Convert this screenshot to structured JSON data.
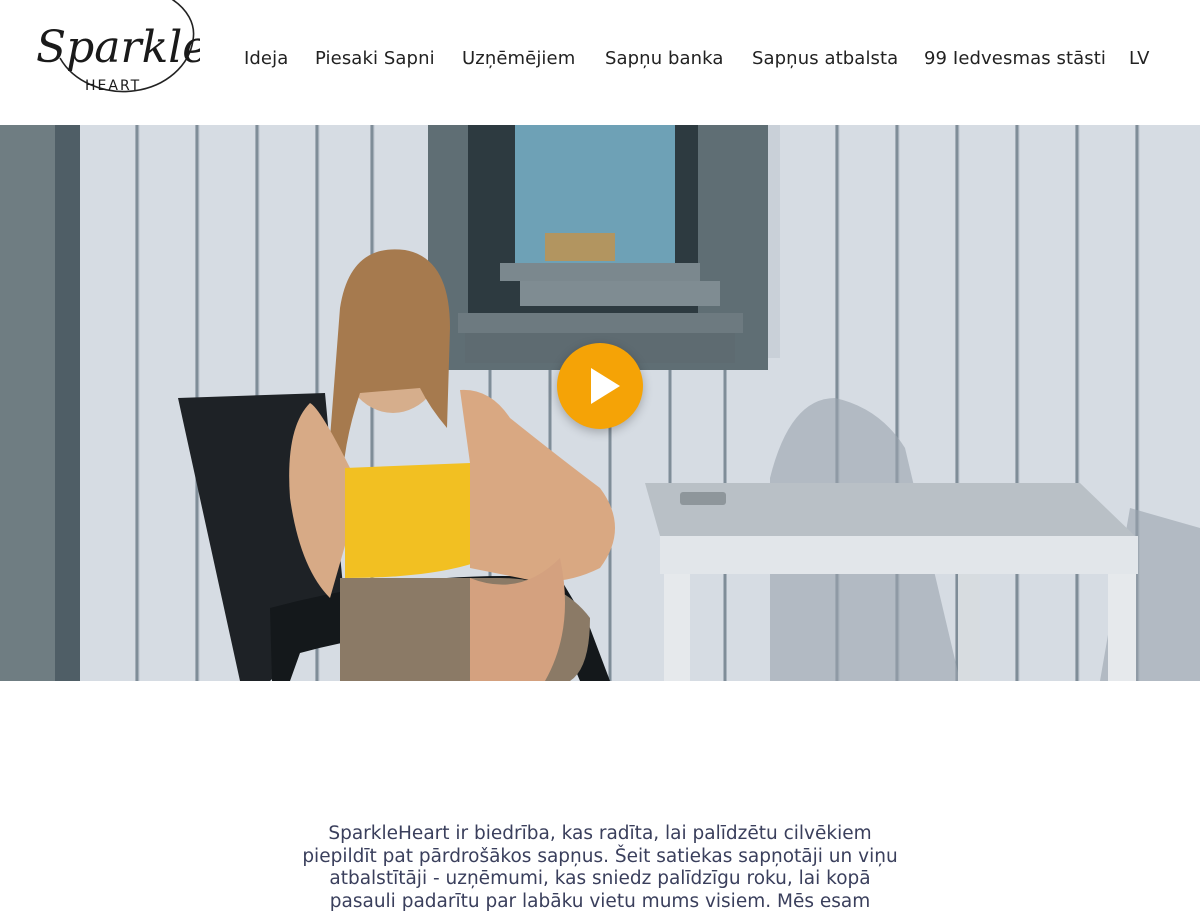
{
  "brand": {
    "logo_main": "Sparkle",
    "logo_sub": "HEART"
  },
  "nav": {
    "items": [
      {
        "label": "Ideja",
        "name": "nav-item-ideja"
      },
      {
        "label": "Piesaki Sapni",
        "name": "nav-item-piesaki-sapni"
      },
      {
        "label": "Uzņēmējiem",
        "name": "nav-item-uznemejiem"
      },
      {
        "label": "Sapņu banka",
        "name": "nav-item-sapnu-banka"
      },
      {
        "label": "Sapņus atbalsta",
        "name": "nav-item-sapnus-atbalsta"
      },
      {
        "label": "99 Iedvesmas stāsti",
        "name": "nav-item-99-iedvesmas-stasti"
      },
      {
        "label": "LV",
        "name": "nav-item-language"
      }
    ]
  },
  "hero": {
    "play_icon": "play-icon",
    "play_color": "#f5a306"
  },
  "intro": {
    "text": "SparkleHeart ir biedrība, kas radīta, lai palīdzētu cilvēkiem piepildīt pat pārdrošākos sapņus. Šeit satiekas sapņotāji un viņu atbalstītāji - uzņēmumi, kas sniedz palīdzīgu roku, lai kopā pasauli padarītu par labāku vietu mums visiem. Mēs esam"
  }
}
